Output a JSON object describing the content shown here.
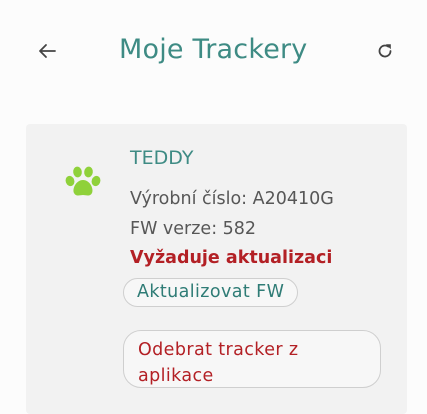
{
  "header": {
    "title": "Moje Trackery",
    "back_icon": "arrow-left-icon",
    "refresh_icon": "refresh-icon",
    "accent_color": "#3e8b84"
  },
  "tracker": {
    "icon": "paw-icon",
    "icon_color": "#8fd13a",
    "name": "TEDDY",
    "serial_text": "Výrobní číslo: A20410G",
    "fw_text": "FW verze: 582",
    "warning_text": "Vyžaduje aktualizaci",
    "warning_color": "#b32025",
    "update_button_label": "Aktualizovat FW",
    "remove_button_label": "Odebrat tracker z aplikace"
  }
}
